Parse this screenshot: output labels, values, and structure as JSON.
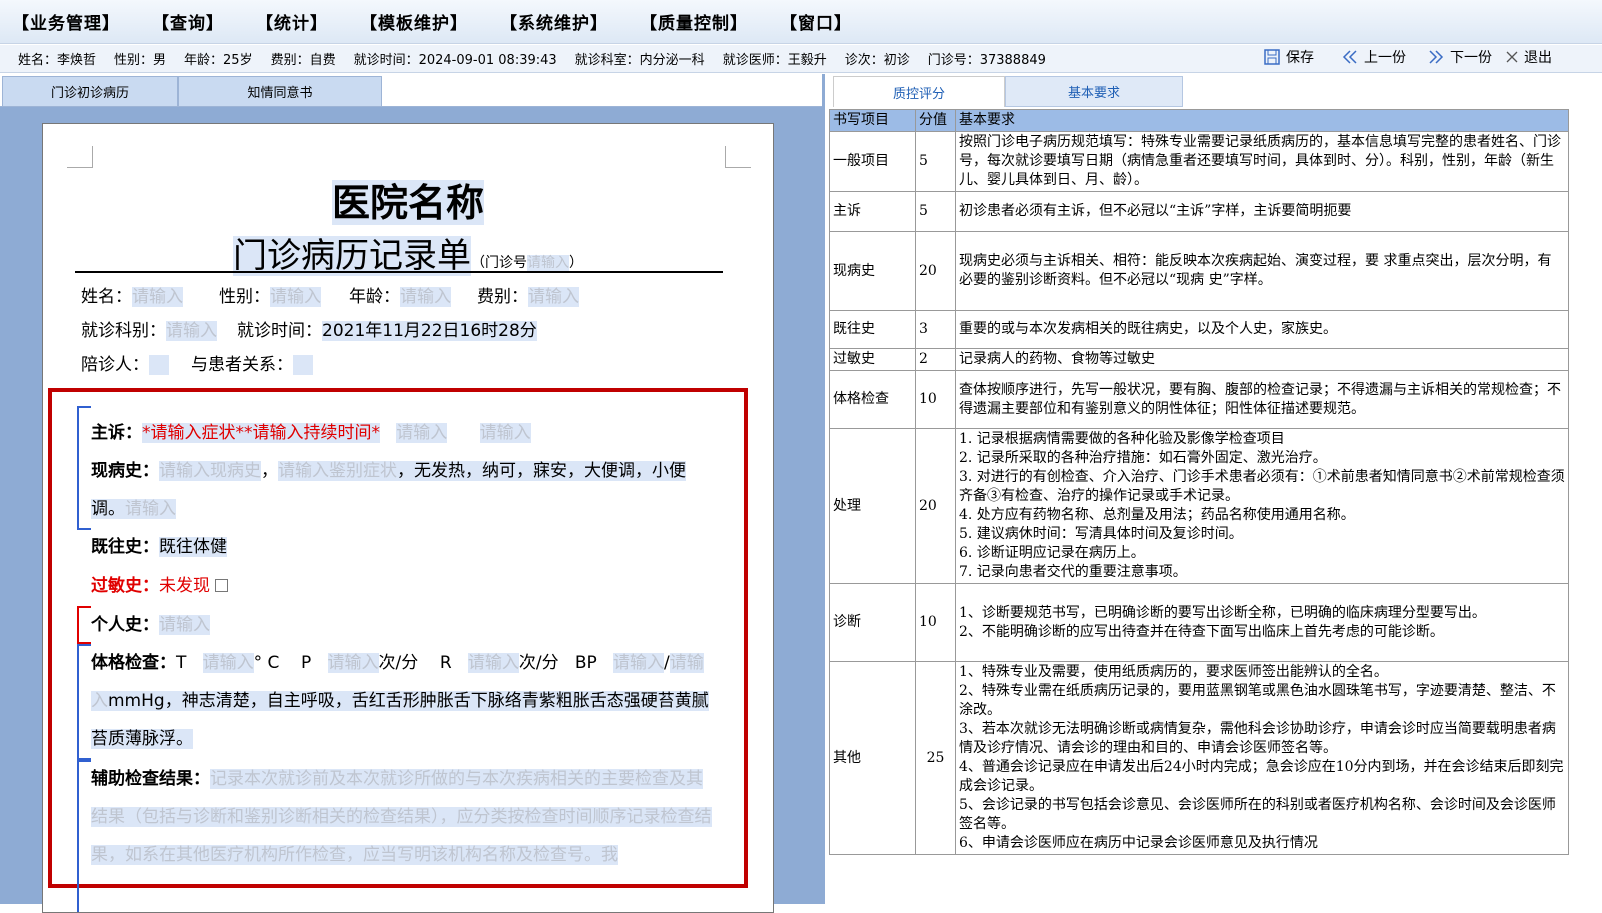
{
  "menu": [
    "【业务管理】",
    "【查询】",
    "【统计】",
    "【模板维护】",
    "【系统维护】",
    "【质量控制】",
    "【窗口】"
  ],
  "info": {
    "name": "姓名：李焕哲",
    "gender": "性别：男",
    "age": "年龄：25岁",
    "fee": "费别：自费",
    "time": "就诊时间：2024-09-01 08:39:43",
    "dept": "就诊科室：内分泌一科",
    "doctor": "就诊医师：王毅升",
    "visit": "诊次：初诊",
    "mzh": "门诊号：37388849"
  },
  "toolbar": {
    "save": "保存",
    "prev": "上一份",
    "next": "下一份",
    "exit": "退出"
  },
  "left_tabs": [
    "门诊初诊病历",
    "知情同意书"
  ],
  "doc": {
    "hospital": "医院名称",
    "title": "门诊病历记录单",
    "title_sub_open": "（门诊号",
    "title_sub_ph": "请输入",
    "title_sub_close": "）",
    "ph": "请输入",
    "name_label": "姓名：",
    "gender_label": "性别：",
    "age_label": "年龄：",
    "fee_label": "费别：",
    "dept_label": "就诊科别：",
    "time_label": "就诊时间：",
    "time_value": "2021年11月22日16时28分",
    "companion_label": "陪诊人：",
    "relation_label": "与患者关系：",
    "cc_label": "主诉：",
    "cc_value": "*请输入症状**请输入持续时间*",
    "hpi_label": "现病史：",
    "hpi_ph1": "请输入现病史",
    "hpi_ph2": "请输入鉴别症状",
    "hpi_text": "，无发热，纳可，寐安，大便调，小便调。",
    "pmh_label": "既往史：",
    "pmh_value": "既往体健",
    "allergy_label": "过敏史：",
    "allergy_value": "未发现",
    "personal_label": "个人史：",
    "exam_label": "体格检查：",
    "exam_T": "T",
    "exam_C": "° C",
    "exam_P": "P",
    "exam_unit": "次/分",
    "exam_R": "R",
    "exam_BP": "BP",
    "exam_slash": "/",
    "exam_text": "mmHg，神志清楚，自主呼吸，舌红舌形肿胀舌下脉络青紫粗胀舌态强硬苔黄腻苔质薄脉浮。",
    "aux_label": "辅助检查结果：",
    "aux_ph": "记录本次就诊前及本次就诊所做的与本次疾病相关的主要检查及其结果（包括与诊断和鉴别诊断相关的检查结果），应分类按检查时间顺序记录检查结果，如系在其他医疗机构所作检查，应当写明该机构名称及检查号。我"
  },
  "right_tabs": [
    "质控评分",
    "基本要求"
  ],
  "table": {
    "headers": [
      "书写项目",
      "分值",
      "基本要求"
    ],
    "rows": [
      {
        "item": "一般项目",
        "score": "5",
        "req": "按照门诊电子病历规范填写：特殊专业需要记录纸质病历的，基本信息填写完整的患者姓名、门诊号，每次就诊要填写日期（病情急重者还要填写时间，具体到时、分）。科别，性别，年龄（新生儿、婴儿具体到日、月、龄）。"
      },
      {
        "item": "主诉",
        "score": "5",
        "req": "初诊患者必须有主诉，但不必冠以“主诉”字样，主诉要简明扼要"
      },
      {
        "item": "现病史",
        "score": "20",
        "req": "现病史必须与主诉相关、相符：能反映本次疾病起始、演变过程，要 求重点突出，层次分明，有必要的鉴别诊断资料。但不必冠以“现病 史”字样。"
      },
      {
        "item": "既往史",
        "score": "3",
        "req": "重要的或与本次发病相关的既往病史，以及个人史，家族史。"
      },
      {
        "item": "过敏史",
        "score": "2",
        "req": "记录病人的药物、食物等过敏史"
      },
      {
        "item": "体格检查",
        "score": "10",
        "req": "查体按顺序进行，先写一般状况，要有胸、腹部的检查记录；不得遗漏与主诉相关的常规检查；不得遗漏主要部位和有鉴别意义的阴性体征；阳性体征描述要规范。"
      },
      {
        "item": "处理",
        "score": "20",
        "lines": [
          "1. 记录根据病情需要做的各种化验及影像学检查项目",
          "2. 记录所采取的各种治疗措施：如石膏外固定、激光治疗。",
          "3. 对进行的有创检查、介入治疗、门诊手术患者必须有：①术前患者知情同意书②术前常规检查须齐备③有检查、治疗的操作记录或手术记录。",
          "4. 处方应有药物名称、总剂量及用法；药品名称使用通用名称。",
          "5. 建议病休时间：写清具体时间及复诊时间。",
          "6. 诊断证明应记录在病历上。",
          "7. 记录向患者交代的重要注意事项。"
        ]
      },
      {
        "item": "诊断",
        "score": "10",
        "lines": [
          "1、诊断要规范书写，已明确诊断的要写出诊断全称，已明确的临床病理分型要写出。",
          "2、不能明确诊断的应写出待查并在待查下面写出临床上首先考虑的可能诊断。"
        ]
      },
      {
        "item": "其他",
        "score": "25",
        "lines": [
          "1、特殊专业及需要，使用纸质病历的，要求医师签出能辨认的全名。",
          "2、特殊专业需在纸质病历记录的，要用蓝黑钢笔或黑色油水圆珠笔书写，字迹要清楚、整洁、不涂改。",
          "3、若本次就诊无法明确诊断或病情复杂，需他科会诊协助诊疗，申请会诊时应当简要载明患者病情及诊疗情况、请会诊的理由和目的、申请会诊医师签名等。",
          "4、普通会诊记录应在申请发出后24小时内完成；急会诊应在10分内到场，并在会诊结束后即刻完成会诊记录。",
          "5、会诊记录的书写包括会诊意见、会诊医师所在的科别或者医疗机构名称、会诊时间及会诊医师签名等。",
          "6、申请会诊医师应在病历中记录会诊医师意见及执行情况"
        ]
      }
    ]
  }
}
